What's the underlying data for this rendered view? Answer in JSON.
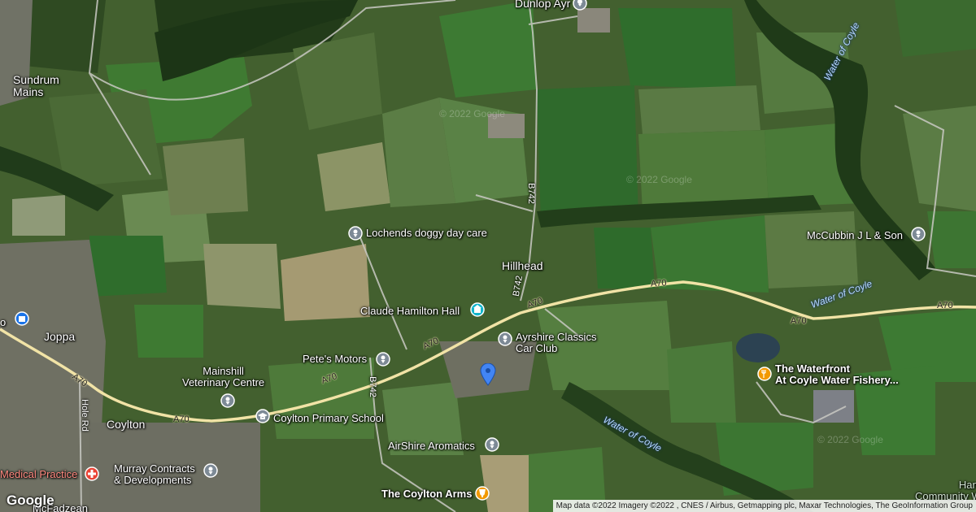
{
  "places": {
    "sundrum_line1": "Sundrum",
    "sundrum_line2": "Mains",
    "dunlop": "Dunlop Ayr",
    "hillhead": "Hillhead",
    "joppa": "Joppa",
    "coylton": "Coylton",
    "hannahs_line1": "Hannahs",
    "hannahs_line2": "Community Woodl",
    "mceadzean": "McFadzean",
    "partial_left": "o"
  },
  "pois": {
    "lochends": "Lochends doggy day care",
    "claude_hamilton": "Claude Hamilton Hall",
    "ayrshire_classics_1": "Ayrshire Classics",
    "ayrshire_classics_2": "Car Club",
    "petes_motors": "Pete's Motors",
    "mainshill_1": "Mainshill",
    "mainshill_2": "Veterinary Centre",
    "coylton_primary": "Coylton Primary School",
    "airshire_aromatics": "AirShire Aromatics",
    "murray_1": "Murray Contracts",
    "murray_2": "& Developments",
    "medical": "Medical Practice",
    "coylton_arms": "The Coylton Arms",
    "waterfront_1": "The Waterfront",
    "waterfront_2": "At Coyle Water Fishery...",
    "mccubbin": "McCubbin J L & Son"
  },
  "roads": {
    "a70": "A70",
    "b742": "B742",
    "hole_rd": "Hole Rd"
  },
  "water": {
    "coyle": "Water of Coyle"
  },
  "watermarks": {
    "w1": "© 2022 Google",
    "w2": "© 2022 Google",
    "w3": "© 2022 Google"
  },
  "footer": {
    "logo": "Google",
    "attribution": "Map data ©2022 Imagery ©2022 , CNES / Airbus, Getmapping plc, Maxar Technologies, The GeoInformation Group"
  },
  "colors": {
    "road_major": "#f1e3a6",
    "road_minor": "#d9d9d9",
    "pin_gray": "#7d8a96",
    "pin_teal": "#12b5cb",
    "pin_orange": "#f29900",
    "pin_red": "#ea4335",
    "pin_blue": "#1a73e8",
    "marker_blue": "#4285f4"
  }
}
